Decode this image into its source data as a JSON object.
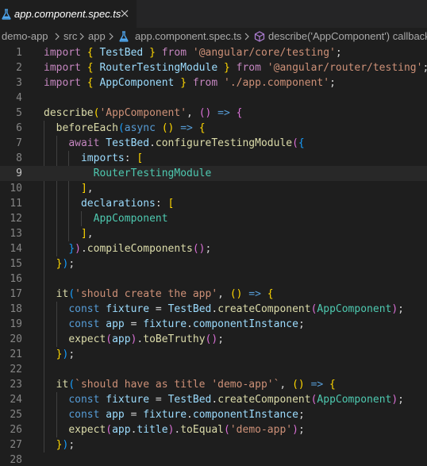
{
  "tab": {
    "label": "app.component.spec.ts",
    "icon": "flask-icon",
    "icon_color": "#4fa7f0"
  },
  "breadcrumb": {
    "items": [
      "demo-app",
      "src",
      "app",
      "app.component.spec.ts",
      "describe('AppComponent') callback"
    ]
  },
  "colors": {
    "keyword": "#c586c0",
    "storage": "#569cd6",
    "string": "#ce9178",
    "type": "#4ec9b0",
    "variable": "#9cdcfe",
    "function": "#dcdcaa",
    "plain": "#d4d4d4",
    "bracket_gold": "#ffd700",
    "bracket_pink": "#da70d6",
    "bracket_blue": "#179fff"
  },
  "editor": {
    "current_line": 9,
    "lines": [
      {
        "n": "1",
        "tokens": [
          [
            "import",
            "keyword"
          ],
          [
            " ",
            "plain"
          ],
          [
            "{",
            "bracket_gold"
          ],
          [
            " ",
            "plain"
          ],
          [
            "TestBed",
            "variable"
          ],
          [
            " ",
            "plain"
          ],
          [
            "}",
            "bracket_gold"
          ],
          [
            " ",
            "plain"
          ],
          [
            "from",
            "keyword"
          ],
          [
            " ",
            "plain"
          ],
          [
            "'@angular/core/testing'",
            "string"
          ],
          [
            ";",
            "plain"
          ]
        ]
      },
      {
        "n": "2",
        "tokens": [
          [
            "import",
            "keyword"
          ],
          [
            " ",
            "plain"
          ],
          [
            "{",
            "bracket_gold"
          ],
          [
            " ",
            "plain"
          ],
          [
            "RouterTestingModule",
            "variable"
          ],
          [
            " ",
            "plain"
          ],
          [
            "}",
            "bracket_gold"
          ],
          [
            " ",
            "plain"
          ],
          [
            "from",
            "keyword"
          ],
          [
            " ",
            "plain"
          ],
          [
            "'@angular/router/testing'",
            "string"
          ],
          [
            ";",
            "plain"
          ]
        ]
      },
      {
        "n": "3",
        "tokens": [
          [
            "import",
            "keyword"
          ],
          [
            " ",
            "plain"
          ],
          [
            "{",
            "bracket_gold"
          ],
          [
            " ",
            "plain"
          ],
          [
            "AppComponent",
            "variable"
          ],
          [
            " ",
            "plain"
          ],
          [
            "}",
            "bracket_gold"
          ],
          [
            " ",
            "plain"
          ],
          [
            "from",
            "keyword"
          ],
          [
            " ",
            "plain"
          ],
          [
            "'./app.component'",
            "string"
          ],
          [
            ";",
            "plain"
          ]
        ]
      },
      {
        "n": "4",
        "tokens": []
      },
      {
        "n": "5",
        "tokens": [
          [
            "describe",
            "function"
          ],
          [
            "(",
            "bracket_gold"
          ],
          [
            "'AppComponent'",
            "string"
          ],
          [
            ", ",
            "plain"
          ],
          [
            "()",
            "bracket_pink"
          ],
          [
            " ",
            "plain"
          ],
          [
            "=>",
            "storage"
          ],
          [
            " ",
            "plain"
          ],
          [
            "{",
            "bracket_pink"
          ]
        ]
      },
      {
        "n": "6",
        "tokens": [
          [
            "  ",
            "plain"
          ],
          [
            "beforeEach",
            "function"
          ],
          [
            "(",
            "bracket_blue"
          ],
          [
            "async",
            "storage"
          ],
          [
            " ",
            "plain"
          ],
          [
            "()",
            "bracket_gold"
          ],
          [
            " ",
            "plain"
          ],
          [
            "=>",
            "storage"
          ],
          [
            " ",
            "plain"
          ],
          [
            "{",
            "bracket_gold"
          ]
        ]
      },
      {
        "n": "7",
        "tokens": [
          [
            "    ",
            "plain"
          ],
          [
            "await",
            "keyword"
          ],
          [
            " ",
            "plain"
          ],
          [
            "TestBed",
            "variable"
          ],
          [
            ".",
            "plain"
          ],
          [
            "configureTestingModule",
            "function"
          ],
          [
            "(",
            "bracket_pink"
          ],
          [
            "{",
            "bracket_blue"
          ]
        ]
      },
      {
        "n": "8",
        "tokens": [
          [
            "      ",
            "plain"
          ],
          [
            "imports",
            "variable"
          ],
          [
            ": ",
            "plain"
          ],
          [
            "[",
            "bracket_gold"
          ]
        ]
      },
      {
        "n": "9",
        "tokens": [
          [
            "        ",
            "plain"
          ],
          [
            "RouterTestingModule",
            "type"
          ]
        ]
      },
      {
        "n": "10",
        "tokens": [
          [
            "      ",
            "plain"
          ],
          [
            "]",
            "bracket_gold"
          ],
          [
            ",",
            "plain"
          ]
        ]
      },
      {
        "n": "11",
        "tokens": [
          [
            "      ",
            "plain"
          ],
          [
            "declarations",
            "variable"
          ],
          [
            ": ",
            "plain"
          ],
          [
            "[",
            "bracket_gold"
          ]
        ]
      },
      {
        "n": "12",
        "tokens": [
          [
            "        ",
            "plain"
          ],
          [
            "AppComponent",
            "type"
          ]
        ]
      },
      {
        "n": "13",
        "tokens": [
          [
            "      ",
            "plain"
          ],
          [
            "]",
            "bracket_gold"
          ],
          [
            ",",
            "plain"
          ]
        ]
      },
      {
        "n": "14",
        "tokens": [
          [
            "    ",
            "plain"
          ],
          [
            "}",
            "bracket_blue"
          ],
          [
            ")",
            "bracket_pink"
          ],
          [
            ".",
            "plain"
          ],
          [
            "compileComponents",
            "function"
          ],
          [
            "()",
            "bracket_pink"
          ],
          [
            ";",
            "plain"
          ]
        ]
      },
      {
        "n": "15",
        "tokens": [
          [
            "  ",
            "plain"
          ],
          [
            "}",
            "bracket_gold"
          ],
          [
            ")",
            "bracket_blue"
          ],
          [
            ";",
            "plain"
          ]
        ]
      },
      {
        "n": "16",
        "tokens": []
      },
      {
        "n": "17",
        "tokens": [
          [
            "  ",
            "plain"
          ],
          [
            "it",
            "function"
          ],
          [
            "(",
            "bracket_blue"
          ],
          [
            "'should create the app'",
            "string"
          ],
          [
            ", ",
            "plain"
          ],
          [
            "()",
            "bracket_gold"
          ],
          [
            " ",
            "plain"
          ],
          [
            "=>",
            "storage"
          ],
          [
            " ",
            "plain"
          ],
          [
            "{",
            "bracket_gold"
          ]
        ]
      },
      {
        "n": "18",
        "tokens": [
          [
            "    ",
            "plain"
          ],
          [
            "const",
            "storage"
          ],
          [
            " ",
            "plain"
          ],
          [
            "fixture",
            "variable"
          ],
          [
            " = ",
            "plain"
          ],
          [
            "TestBed",
            "variable"
          ],
          [
            ".",
            "plain"
          ],
          [
            "createComponent",
            "function"
          ],
          [
            "(",
            "bracket_pink"
          ],
          [
            "AppComponent",
            "type"
          ],
          [
            ")",
            "bracket_pink"
          ],
          [
            ";",
            "plain"
          ]
        ]
      },
      {
        "n": "19",
        "tokens": [
          [
            "    ",
            "plain"
          ],
          [
            "const",
            "storage"
          ],
          [
            " ",
            "plain"
          ],
          [
            "app",
            "variable"
          ],
          [
            " = ",
            "plain"
          ],
          [
            "fixture",
            "variable"
          ],
          [
            ".",
            "plain"
          ],
          [
            "componentInstance",
            "variable"
          ],
          [
            ";",
            "plain"
          ]
        ]
      },
      {
        "n": "20",
        "tokens": [
          [
            "    ",
            "plain"
          ],
          [
            "expect",
            "function"
          ],
          [
            "(",
            "bracket_pink"
          ],
          [
            "app",
            "variable"
          ],
          [
            ")",
            "bracket_pink"
          ],
          [
            ".",
            "plain"
          ],
          [
            "toBeTruthy",
            "function"
          ],
          [
            "()",
            "bracket_pink"
          ],
          [
            ";",
            "plain"
          ]
        ]
      },
      {
        "n": "21",
        "tokens": [
          [
            "  ",
            "plain"
          ],
          [
            "}",
            "bracket_gold"
          ],
          [
            ")",
            "bracket_blue"
          ],
          [
            ";",
            "plain"
          ]
        ]
      },
      {
        "n": "22",
        "tokens": []
      },
      {
        "n": "23",
        "tokens": [
          [
            "  ",
            "plain"
          ],
          [
            "it",
            "function"
          ],
          [
            "(",
            "bracket_blue"
          ],
          [
            "`should have as title 'demo-app'`",
            "string"
          ],
          [
            ", ",
            "plain"
          ],
          [
            "()",
            "bracket_gold"
          ],
          [
            " ",
            "plain"
          ],
          [
            "=>",
            "storage"
          ],
          [
            " ",
            "plain"
          ],
          [
            "{",
            "bracket_gold"
          ]
        ]
      },
      {
        "n": "24",
        "tokens": [
          [
            "    ",
            "plain"
          ],
          [
            "const",
            "storage"
          ],
          [
            " ",
            "plain"
          ],
          [
            "fixture",
            "variable"
          ],
          [
            " = ",
            "plain"
          ],
          [
            "TestBed",
            "variable"
          ],
          [
            ".",
            "plain"
          ],
          [
            "createComponent",
            "function"
          ],
          [
            "(",
            "bracket_pink"
          ],
          [
            "AppComponent",
            "type"
          ],
          [
            ")",
            "bracket_pink"
          ],
          [
            ";",
            "plain"
          ]
        ]
      },
      {
        "n": "25",
        "tokens": [
          [
            "    ",
            "plain"
          ],
          [
            "const",
            "storage"
          ],
          [
            " ",
            "plain"
          ],
          [
            "app",
            "variable"
          ],
          [
            " = ",
            "plain"
          ],
          [
            "fixture",
            "variable"
          ],
          [
            ".",
            "plain"
          ],
          [
            "componentInstance",
            "variable"
          ],
          [
            ";",
            "plain"
          ]
        ]
      },
      {
        "n": "26",
        "tokens": [
          [
            "    ",
            "plain"
          ],
          [
            "expect",
            "function"
          ],
          [
            "(",
            "bracket_pink"
          ],
          [
            "app",
            "variable"
          ],
          [
            ".",
            "plain"
          ],
          [
            "title",
            "variable"
          ],
          [
            ")",
            "bracket_pink"
          ],
          [
            ".",
            "plain"
          ],
          [
            "toEqual",
            "function"
          ],
          [
            "(",
            "bracket_pink"
          ],
          [
            "'demo-app'",
            "string"
          ],
          [
            ")",
            "bracket_pink"
          ],
          [
            ";",
            "plain"
          ]
        ]
      },
      {
        "n": "27",
        "tokens": [
          [
            "  ",
            "plain"
          ],
          [
            "}",
            "bracket_gold"
          ],
          [
            ")",
            "bracket_blue"
          ],
          [
            ";",
            "plain"
          ]
        ]
      },
      {
        "n": "28",
        "tokens": []
      }
    ]
  }
}
